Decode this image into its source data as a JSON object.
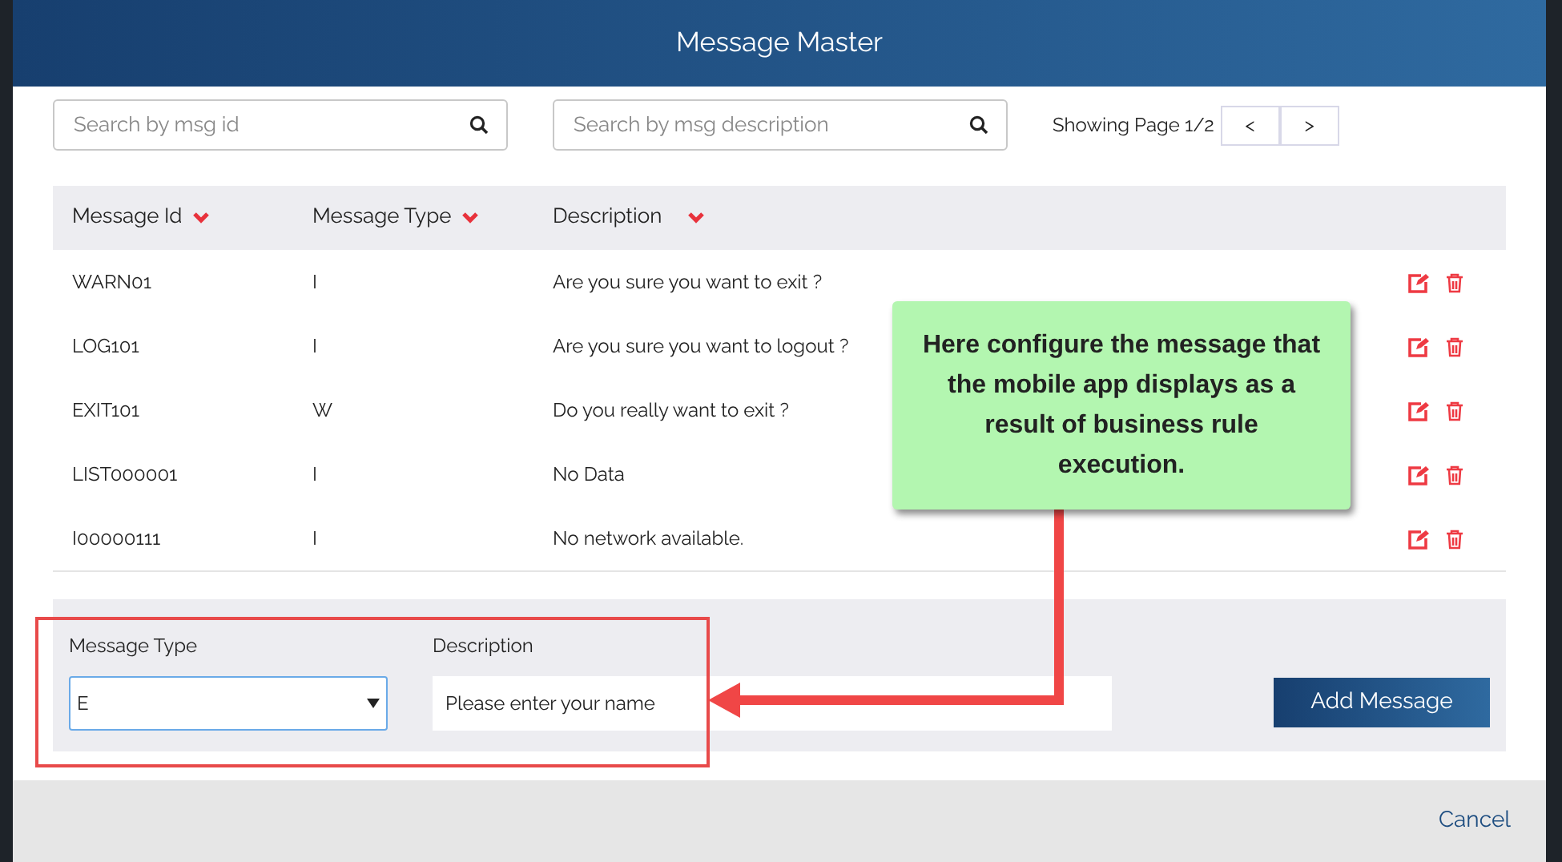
{
  "dialog": {
    "title": "Message Master"
  },
  "search": [
    {
      "placeholder": "Search by msg id"
    },
    {
      "placeholder": "Search by msg description"
    }
  ],
  "pager": {
    "text": "Showing Page 1/2",
    "buttons": [
      "<",
      ">"
    ]
  },
  "table": {
    "columns": [
      {
        "label": "Message Id"
      },
      {
        "label": "Message Type"
      },
      {
        "label": "Description"
      }
    ],
    "rows": [
      {
        "cells": [
          "WARN01",
          "I",
          "Are you sure you want to exit ?"
        ]
      },
      {
        "cells": [
          "LOG101",
          "I",
          "Are you sure you want to logout ?"
        ]
      },
      {
        "cells": [
          "EXIT101",
          "W",
          "Do you really want to exit ?"
        ]
      },
      {
        "cells": [
          "LIST000001",
          "I",
          "No Data"
        ]
      },
      {
        "cells": [
          "I00000111",
          "I",
          "No network available."
        ]
      }
    ]
  },
  "form": {
    "type_label": "Message Type",
    "type_value": "E",
    "description_label": "Description",
    "description_value": "Please enter your name",
    "add_button": "Add Message"
  },
  "footer": {
    "cancel": "Cancel"
  },
  "annotation": {
    "text": "Here configure the message that the mobile app displays as a result of business rule execution."
  }
}
